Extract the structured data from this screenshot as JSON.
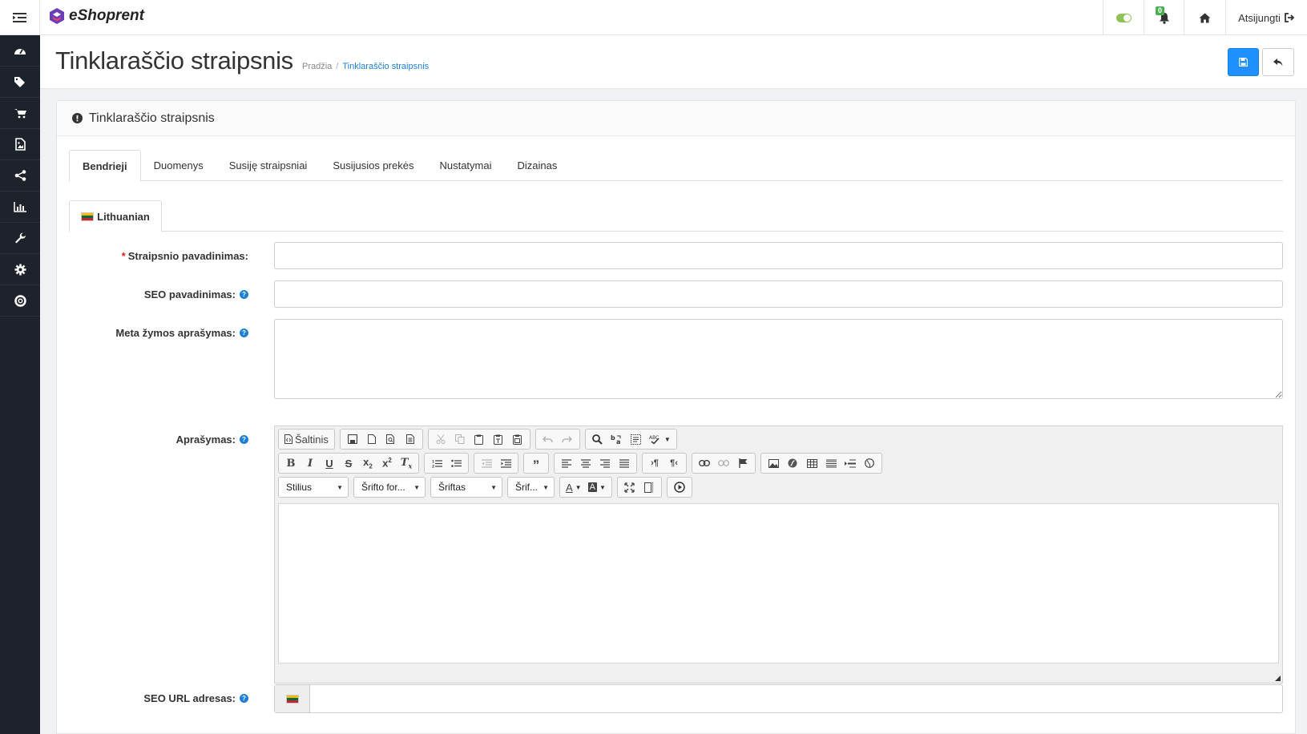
{
  "brand": {
    "name": "eShoprent"
  },
  "topbar": {
    "notification_count": "0",
    "logout_label": "Atsijungti"
  },
  "sidebar": {
    "items": [
      {
        "icon": "dashboard-icon"
      },
      {
        "icon": "tags-icon"
      },
      {
        "icon": "cart-icon"
      },
      {
        "icon": "image-file-icon"
      },
      {
        "icon": "share-icon"
      },
      {
        "icon": "bar-chart-icon"
      },
      {
        "icon": "wrench-icon"
      },
      {
        "icon": "gear-icon"
      },
      {
        "icon": "lifebuoy-icon"
      }
    ]
  },
  "page": {
    "title": "Tinklaraščio straipsnis",
    "breadcrumb": {
      "home": "Pradžia",
      "separator": "/",
      "current": "Tinklaraščio straipsnis"
    }
  },
  "panel": {
    "heading": "Tinklaraščio straipsnis",
    "tabs": [
      "Bendrieji",
      "Duomenys",
      "Susiję straipsniai",
      "Susijusios prekės",
      "Nustatymai",
      "Dizainas"
    ],
    "active_tab": "Bendrieji",
    "language_tab": "Lithuanian"
  },
  "form": {
    "title_label": "Straipsnio pavadinimas:",
    "title_required": "*",
    "title_value": "",
    "seo_title_label": "SEO pavadinimas:",
    "seo_title_value": "",
    "meta_desc_label": "Meta žymos aprašymas:",
    "meta_desc_value": "",
    "description_label": "Aprašymas:",
    "seo_url_label": "SEO URL adresas:",
    "seo_url_value": "",
    "help_glyph": "?"
  },
  "editor": {
    "source_label": "Šaltinis",
    "combos": {
      "style": "Stilius",
      "format": "Šrifto for...",
      "font": "Šriftas",
      "size": "Šrif..."
    },
    "text_color_label": "A",
    "bg_color_label": "A"
  },
  "colors": {
    "sidebar_bg": "#1e222a",
    "primary": "#1e90ff",
    "link": "#1e7fd6",
    "toggle_on": "#8fc355",
    "required": "#e02020"
  }
}
